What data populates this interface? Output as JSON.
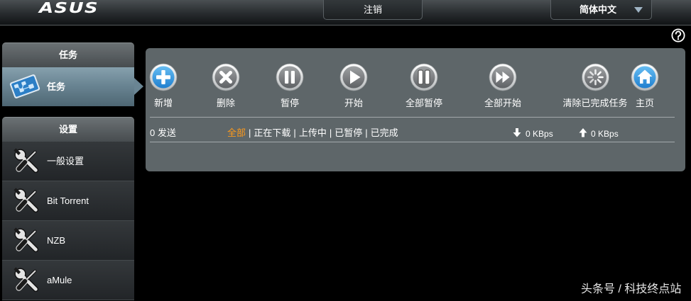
{
  "header": {
    "logo_text": "ASUS",
    "logout_label": "注销",
    "language_label": "简体中文",
    "language_icon": "dropdown-triangle-icon",
    "help_icon": "help-icon"
  },
  "sidebar": {
    "tasks_group": {
      "title": "任务",
      "items": [
        {
          "label": "任务",
          "icon": "task-tablet-icon",
          "active": true
        }
      ]
    },
    "settings_group": {
      "title": "设置",
      "items": [
        {
          "label": "一般设置",
          "icon": "wrench-screwdriver-icon"
        },
        {
          "label": "Bit Torrent",
          "icon": "wrench-screwdriver-icon"
        },
        {
          "label": "NZB",
          "icon": "wrench-screwdriver-icon"
        },
        {
          "label": "aMule",
          "icon": "wrench-screwdriver-icon"
        }
      ]
    }
  },
  "toolbar": {
    "buttons": [
      {
        "label": "新增",
        "icon": "plus-icon"
      },
      {
        "label": "删除",
        "icon": "delete-x-icon"
      },
      {
        "label": "暂停",
        "icon": "pause-icon"
      },
      {
        "label": "开始",
        "icon": "play-icon"
      },
      {
        "label": "全部暂停",
        "icon": "pause-all-icon"
      },
      {
        "label": "全部开始",
        "icon": "start-all-icon"
      },
      {
        "label": "清除已完成任务",
        "icon": "clear-completed-icon"
      },
      {
        "label": "主页",
        "icon": "home-icon"
      }
    ]
  },
  "status": {
    "sent_count": "0 发送",
    "filters": [
      {
        "label": "全部",
        "active": true
      },
      {
        "label": "正在下载",
        "active": false
      },
      {
        "label": "上传中",
        "active": false
      },
      {
        "label": "已暂停",
        "active": false
      },
      {
        "label": "已完成",
        "active": false
      }
    ],
    "separator": "|",
    "download_icon": "download-arrow-icon",
    "download_speed": "0 KBps",
    "upload_icon": "upload-arrow-icon",
    "upload_speed": "0 KBps"
  },
  "watermark": "头条号 / 科技终点站",
  "colors": {
    "active_filter": "#ff9a1a",
    "icon_blue": "#1f7fcf",
    "panel": "#5e6669",
    "active_nav": "#6a8593"
  }
}
